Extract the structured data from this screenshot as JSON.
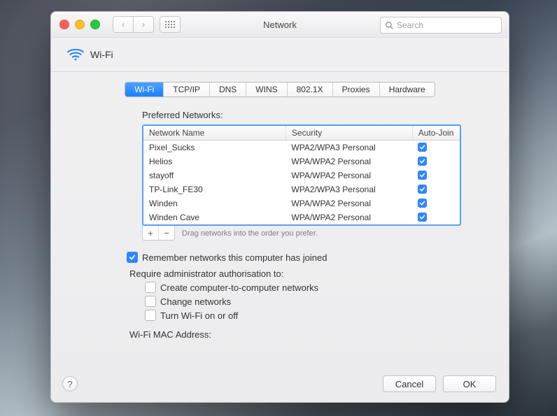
{
  "window": {
    "title": "Network"
  },
  "search": {
    "placeholder": "Search"
  },
  "header": {
    "icon": "wifi-icon",
    "label": "Wi-Fi"
  },
  "tabs": [
    {
      "label": "Wi-Fi",
      "active": true
    },
    {
      "label": "TCP/IP",
      "active": false
    },
    {
      "label": "DNS",
      "active": false
    },
    {
      "label": "WINS",
      "active": false
    },
    {
      "label": "802.1X",
      "active": false
    },
    {
      "label": "Proxies",
      "active": false
    },
    {
      "label": "Hardware",
      "active": false
    }
  ],
  "preferred": {
    "title": "Preferred Networks:",
    "columns": {
      "name": "Network Name",
      "security": "Security",
      "autojoin": "Auto-Join"
    },
    "rows": [
      {
        "name": "Pixel_Sucks",
        "security": "WPA2/WPA3 Personal",
        "autojoin": true
      },
      {
        "name": "Helios",
        "security": "WPA/WPA2 Personal",
        "autojoin": true
      },
      {
        "name": "stayoff",
        "security": "WPA/WPA2 Personal",
        "autojoin": true
      },
      {
        "name": "TP-Link_FE30",
        "security": "WPA2/WPA3 Personal",
        "autojoin": true
      },
      {
        "name": "Winden",
        "security": "WPA/WPA2 Personal",
        "autojoin": true
      },
      {
        "name": "Winden Cave",
        "security": "WPA/WPA2 Personal",
        "autojoin": true
      }
    ],
    "hint": "Drag networks into the order you prefer."
  },
  "options": {
    "remember": {
      "label": "Remember networks this computer has joined",
      "checked": true
    },
    "require_label": "Require administrator authorisation to:",
    "create_c2c": {
      "label": "Create computer-to-computer networks",
      "checked": false
    },
    "change_net": {
      "label": "Change networks",
      "checked": false
    },
    "toggle_wifi": {
      "label": "Turn Wi-Fi on or off",
      "checked": false
    }
  },
  "mac": {
    "label": "Wi-Fi MAC Address:",
    "value": ""
  },
  "buttons": {
    "cancel": "Cancel",
    "ok": "OK"
  },
  "pm": {
    "add": "+",
    "remove": "−"
  }
}
